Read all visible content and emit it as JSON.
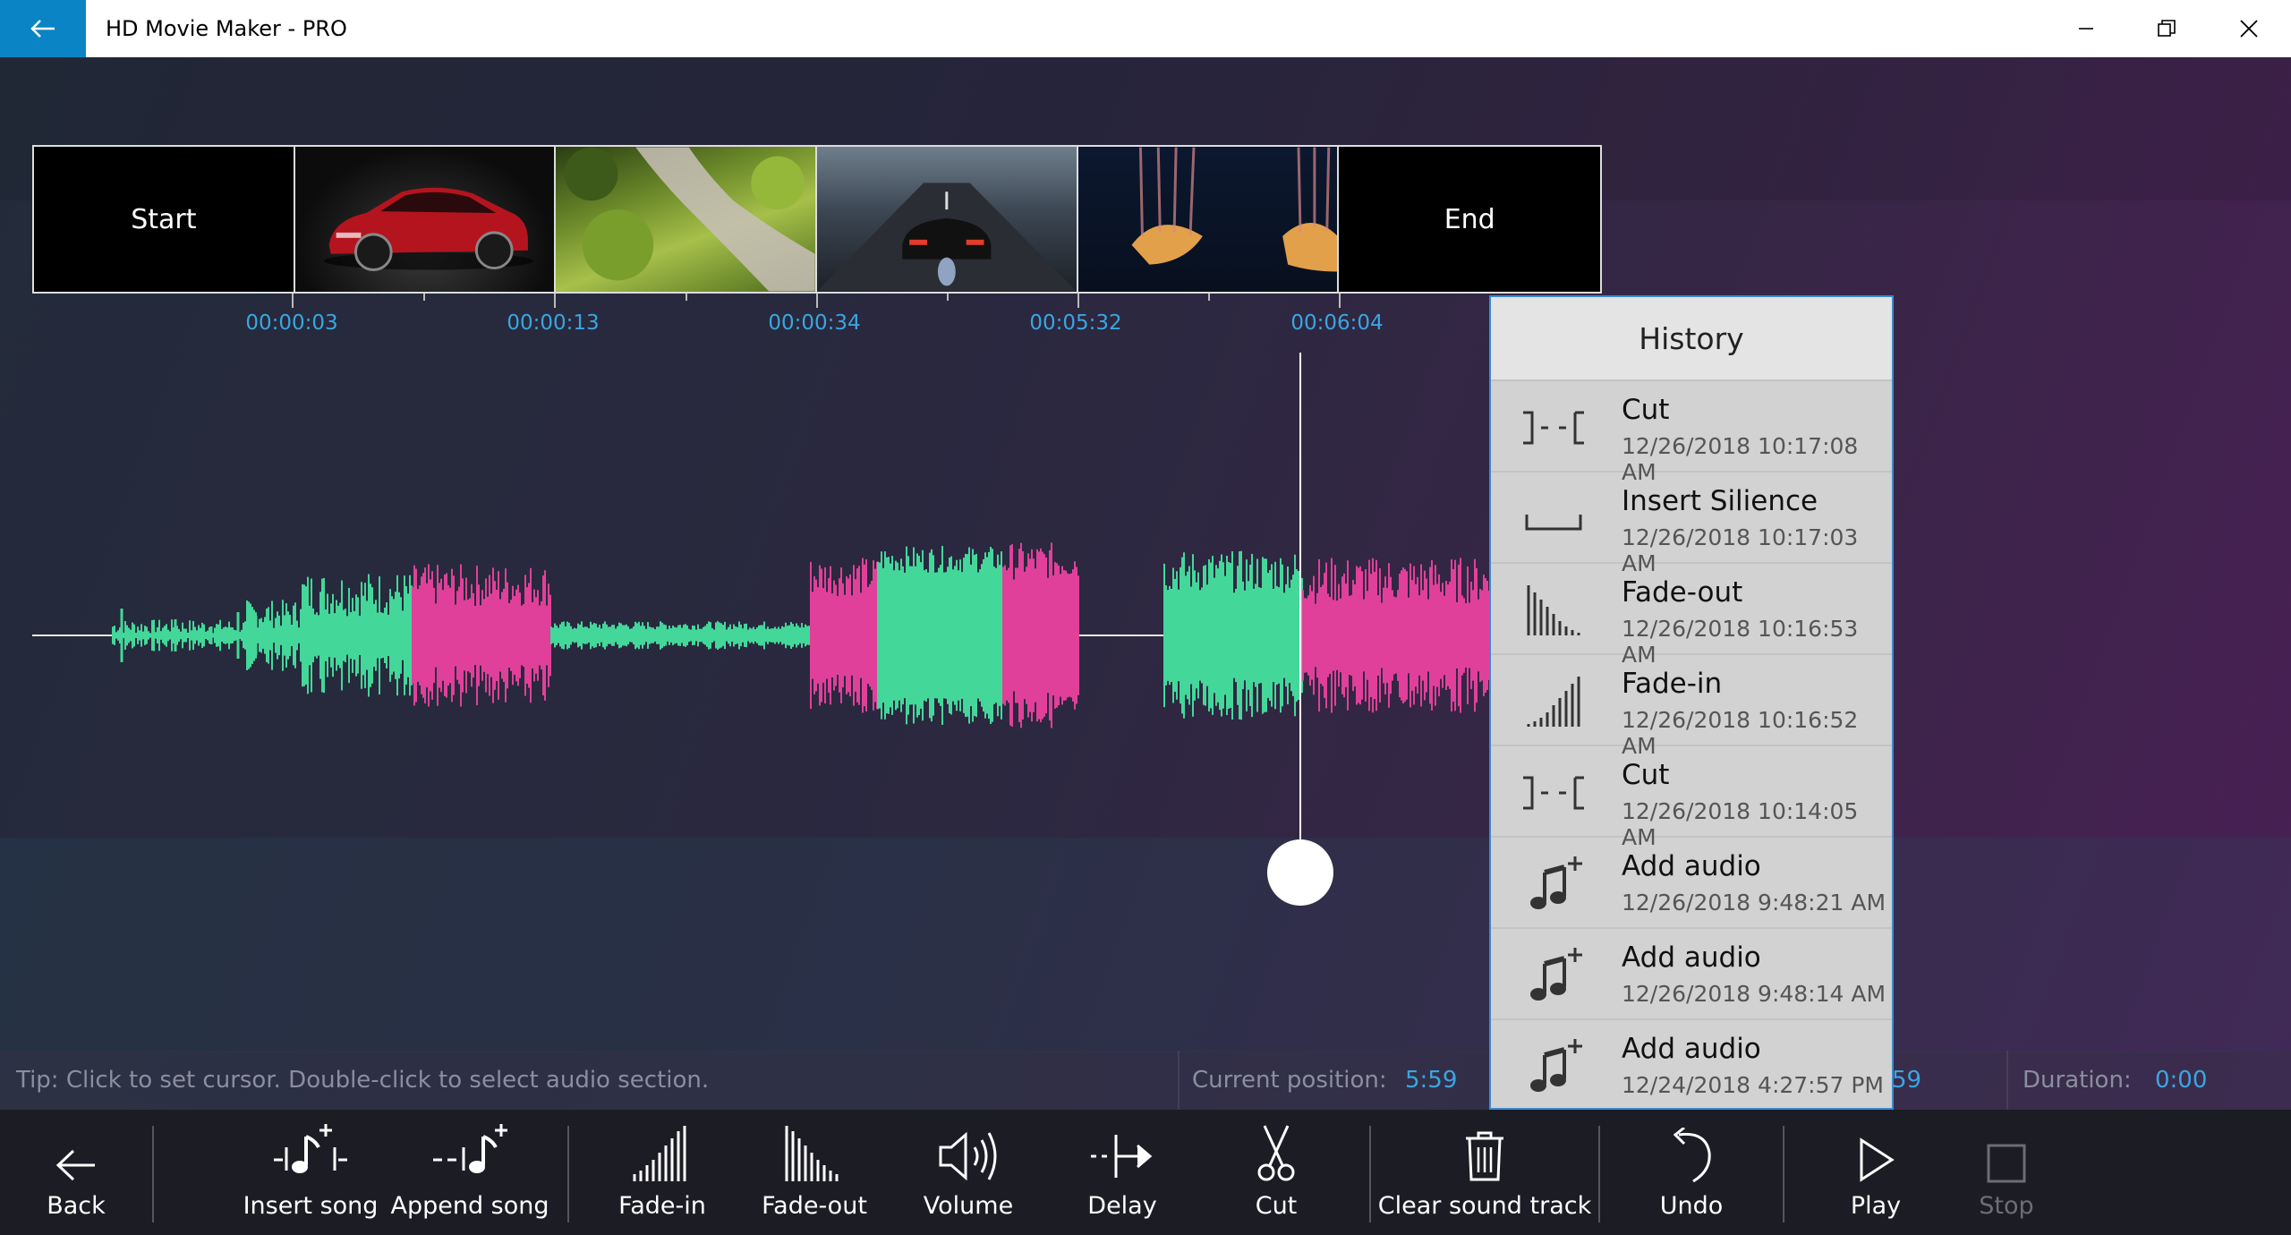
{
  "window": {
    "title": "HD Movie Maker - PRO"
  },
  "timeline": {
    "start_label": "Start",
    "end_label": "End",
    "clips": [
      {
        "subject": "red car"
      },
      {
        "subject": "green stream landscape"
      },
      {
        "subject": "sports car on road"
      },
      {
        "subject": "jellyfish"
      }
    ],
    "time_labels": [
      "00:00:03",
      "00:00:13",
      "00:00:34",
      "00:05:32",
      "00:06:04"
    ]
  },
  "history": {
    "title": "History",
    "items": [
      {
        "name": "Cut",
        "date": "12/26/2018 10:17:08 AM",
        "icon": "cut-icon"
      },
      {
        "name": "Insert Silience",
        "date": "12/26/2018 10:17:03 AM",
        "icon": "silence-icon"
      },
      {
        "name": "Fade-out",
        "date": "12/26/2018 10:16:53 AM",
        "icon": "fade-out-icon"
      },
      {
        "name": "Fade-in",
        "date": "12/26/2018 10:16:52 AM",
        "icon": "fade-in-icon"
      },
      {
        "name": "Cut",
        "date": "12/26/2018 10:14:05 AM",
        "icon": "cut-icon"
      },
      {
        "name": "Add audio",
        "date": "12/26/2018 9:48:21 AM",
        "icon": "add-audio-icon"
      },
      {
        "name": "Add audio",
        "date": "12/26/2018 9:48:14 AM",
        "icon": "add-audio-icon"
      },
      {
        "name": "Add audio",
        "date": "12/24/2018 4:27:57 PM",
        "icon": "add-audio-icon"
      }
    ]
  },
  "status": {
    "tip": "Tip: Click to set cursor. Double-click to select audio section.",
    "current_position_label": "Current position:",
    "current_position_value": "5:59",
    "partial_value": "59",
    "duration_label": "Duration:",
    "duration_value": "0:00"
  },
  "toolbar": {
    "back": "Back",
    "insert_song": "Insert song",
    "append_song": "Append song",
    "fade_in": "Fade-in",
    "fade_out": "Fade-out",
    "volume": "Volume",
    "delay": "Delay",
    "cut": "Cut",
    "clear_sound_track": "Clear sound track",
    "undo": "Undo",
    "play": "Play",
    "stop": "Stop"
  },
  "colors": {
    "accent": "#0a84c4",
    "wave_green": "#44d79a",
    "wave_pink": "#e0409a",
    "time_label": "#3aa6e0"
  }
}
